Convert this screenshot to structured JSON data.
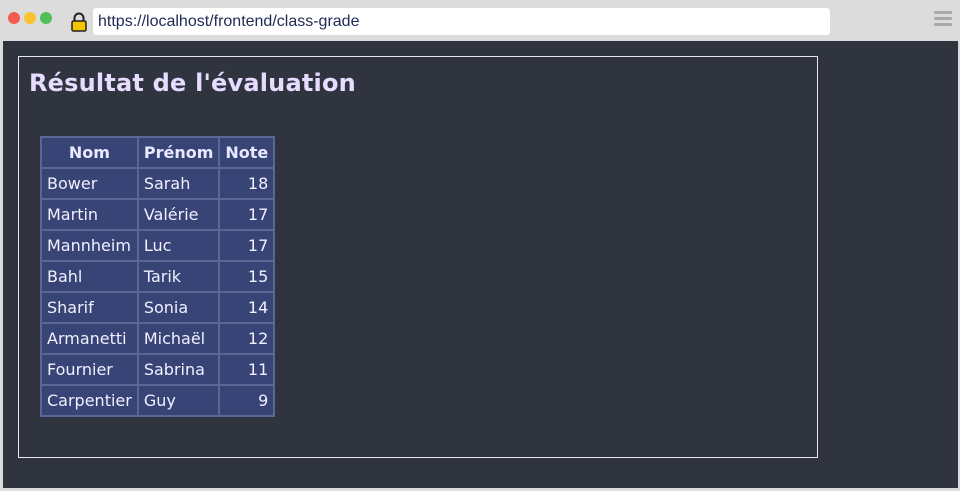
{
  "browser": {
    "url": "https://localhost/frontend/class-grade",
    "icons": [
      "close-dot",
      "minimize-dot",
      "maximize-dot",
      "lock-icon",
      "menu-icon"
    ]
  },
  "page": {
    "title": "Résultat de l'évaluation"
  },
  "table": {
    "headers": [
      "Nom",
      "Prénom",
      "Note"
    ],
    "rows": [
      [
        "Bower",
        "Sarah",
        "18"
      ],
      [
        "Martin",
        "Valérie",
        "17"
      ],
      [
        "Mannheim",
        "Luc",
        "17"
      ],
      [
        "Bahl",
        "Tarik",
        "15"
      ],
      [
        "Sharif",
        "Sonia",
        "14"
      ],
      [
        "Armanetti",
        "Michaël",
        "12"
      ],
      [
        "Fournier",
        "Sabrina",
        "11"
      ],
      [
        "Carpentier",
        "Guy",
        "9"
      ]
    ]
  },
  "colors": {
    "page_background": "#30343f",
    "table_cell": "#374475",
    "table_border": "#5a6895",
    "title_text": "#e6dcff"
  }
}
